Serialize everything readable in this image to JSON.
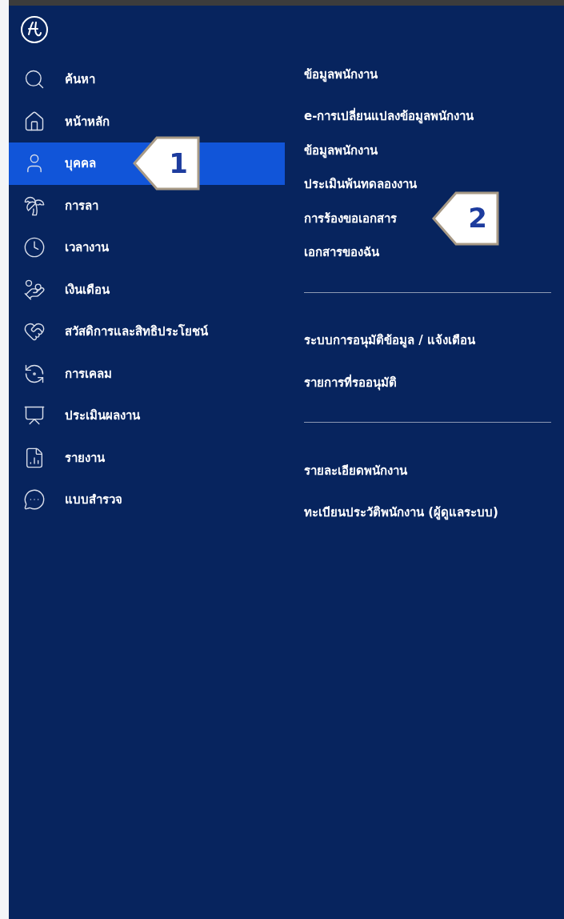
{
  "sidebar": {
    "items": [
      {
        "label": "ค้นหา",
        "selected": false
      },
      {
        "label": "หน้าหลัก",
        "selected": false
      },
      {
        "label": "บุคคล",
        "selected": true,
        "callout": "1"
      },
      {
        "label": "การลา",
        "selected": false
      },
      {
        "label": "เวลางาน",
        "selected": false
      },
      {
        "label": "เงินเดือน",
        "selected": false
      },
      {
        "label": "สวัสดิการและสิทธิประโยชน์",
        "selected": false
      },
      {
        "label": "การเคลม",
        "selected": false
      },
      {
        "label": "ประเมินผลงาน",
        "selected": false
      },
      {
        "label": "รายงาน",
        "selected": false
      },
      {
        "label": "แบบสำรวจ",
        "selected": false
      }
    ]
  },
  "submenu": {
    "sections": [
      {
        "heading": "ข้อมูลพนักงาน",
        "items": [
          {
            "label": "e-การเปลี่ยนแปลงข้อมูลพนักงาน"
          },
          {
            "label": "ข้อมูลพนักงาน"
          },
          {
            "label": "ประเมินพ้นทดลองงาน"
          },
          {
            "label": "การร้องขอเอกสาร",
            "callout": "2"
          },
          {
            "label": "เอกสารของฉัน"
          }
        ]
      },
      {
        "heading": "ระบบการอนุมัติข้อมูล / แจ้งเตือน",
        "items": [
          {
            "label": "รายการที่รออนุมัติ"
          }
        ]
      },
      {
        "heading": "รายละเอียดพนักงาน",
        "items": [
          {
            "label": "ทะเบียนประวัติพนักงาน (ผู้ดูแลระบบ)"
          }
        ]
      }
    ]
  }
}
